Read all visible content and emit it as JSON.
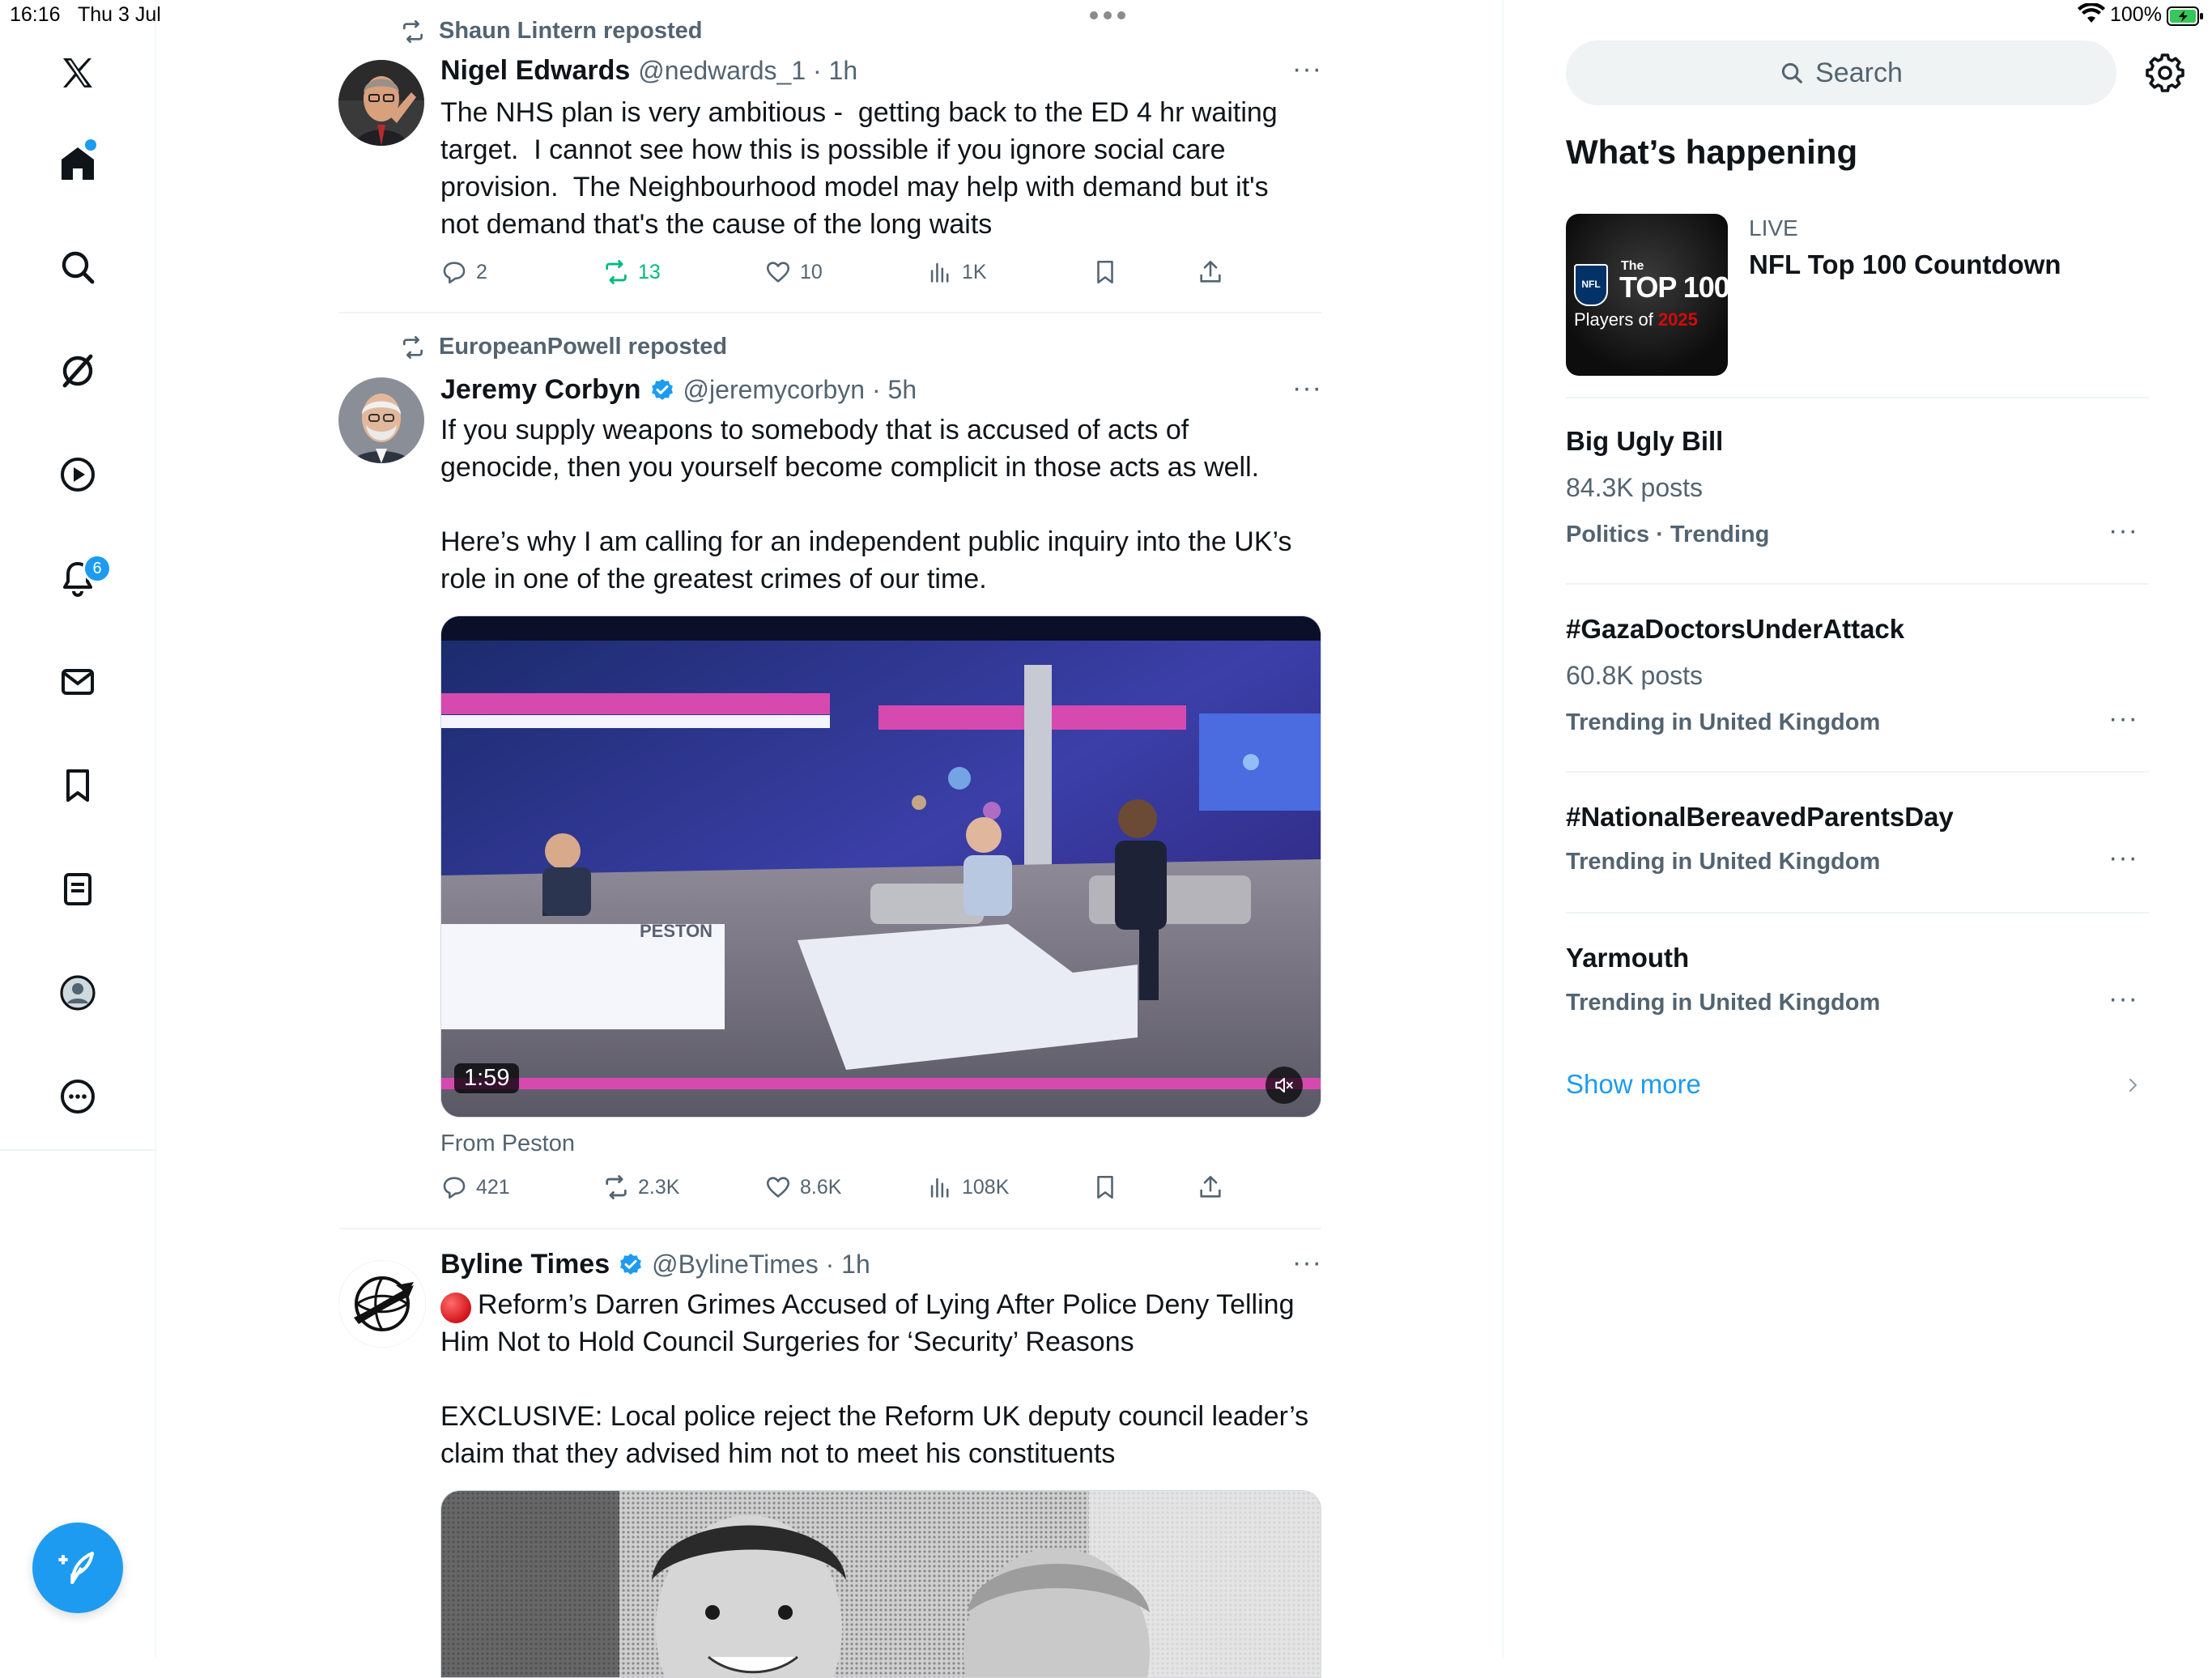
{
  "status_bar": {
    "time": "16:16",
    "date": "Thu 3 Jul",
    "battery": "100%"
  },
  "nav": {
    "items": [
      "x-logo",
      "home",
      "search",
      "grok",
      "video",
      "notifications",
      "messages",
      "bookmarks",
      "lists",
      "profile",
      "more"
    ],
    "notifications_badge": "6"
  },
  "tweets": [
    {
      "repost_by": "Shaun Lintern reposted",
      "name": "Nigel Edwards",
      "handle": "@nedwards_1 · 1h",
      "text": "The NHS plan is very ambitious -  getting back to the ED 4 hr waiting\ntarget.  I cannot see how this is possible if you ignore social care\nprovision.  The Neighbourhood model may help with demand but it's\nnot demand that's the cause of the long waits",
      "replies": "2",
      "reposts": "13",
      "likes": "10",
      "views": "1K"
    },
    {
      "repost_by": "EuropeanPowell reposted",
      "name": "Jeremy Corbyn",
      "handle": "@jeremycorbyn · 5h",
      "text": "If you supply weapons to somebody that is accused of acts of\ngenocide, then you yourself become complicit in those acts as well.\n\nHere’s why I am calling for an independent public inquiry into the UK’s\nrole in one of the greatest crimes of our time.",
      "video_duration": "1:59",
      "video_set_label": "PESTON",
      "from": "From Peston",
      "replies": "421",
      "reposts": "2.3K",
      "likes": "8.6K",
      "views": "108K"
    },
    {
      "name": "Byline Times",
      "handle": "@BylineTimes · 1h",
      "text": "Reform’s Darren Grimes Accused of Lying After Police Deny Telling\nHim Not to Hold Council Surgeries for ‘Security’ Reasons\n\nEXCLUSIVE: Local police reject the Reform UK deputy council leader’s\nclaim that they advised him not to meet his constituents"
    }
  ],
  "right": {
    "search_placeholder": "Search",
    "title": "What’s happening",
    "live": {
      "label": "LIVE",
      "title": "NFL Top 100 Countdown",
      "thumb_line1": "The",
      "thumb_line2": "TOP 100",
      "thumb_line3a": "Players of ",
      "thumb_line3b": "2025",
      "thumb_logo": "NFL"
    },
    "trends": [
      {
        "title": "Big Ugly Bill",
        "posts": "84.3K posts",
        "meta": "Politics · Trending"
      },
      {
        "title": "#GazaDoctorsUnderAttack",
        "posts": "60.8K posts",
        "meta": "Trending in United Kingdom"
      },
      {
        "title": "#NationalBereavedParentsDay",
        "posts": "",
        "meta": "Trending in United Kingdom"
      },
      {
        "title": "Yarmouth",
        "posts": "",
        "meta": "Trending in United Kingdom"
      }
    ],
    "show_more": "Show more"
  },
  "colors": {
    "accent": "#1d9bf0",
    "repost_green": "#00ba7c",
    "text": "#0f1419",
    "secondary": "#536471"
  }
}
